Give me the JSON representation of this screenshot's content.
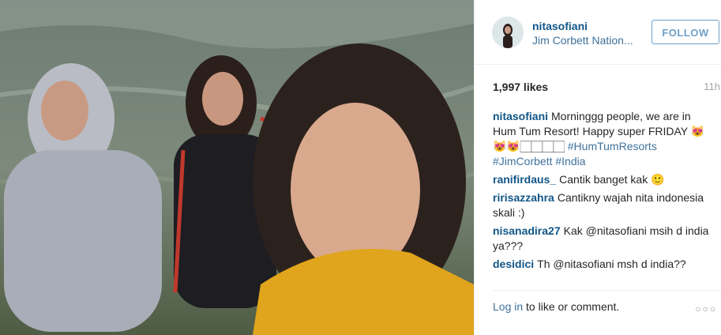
{
  "post": {
    "author": {
      "username": "nitasofiani",
      "location": "Jim Corbett Nation..."
    },
    "follow_label": "FOLLOW",
    "likes": "1,997 likes",
    "time": "11h",
    "caption": {
      "user": "nitasofiani",
      "text": "Morninggg people, we are in Hum Tum Resort! Happy super FRIDAY 😻😻😻🏻🏻🏻🏻",
      "hashtags": "#HumTumResorts #JimCorbett #India"
    },
    "comments": [
      {
        "user": "ranifirdaus_",
        "text": "Cantik banget kak 🙂"
      },
      {
        "user": "ririsazzahra",
        "text": "Cantikny wajah nita indonesia skali :)"
      },
      {
        "user": "nisanadira27",
        "text": "Kak @nitasofiani msih d india ya???"
      },
      {
        "user": "desidici",
        "text": "Th @nitasofiani msh d india??"
      }
    ],
    "footer": {
      "login_link": "Log in",
      "login_rest": " to like or comment.",
      "more_icon": "more-icon"
    }
  }
}
